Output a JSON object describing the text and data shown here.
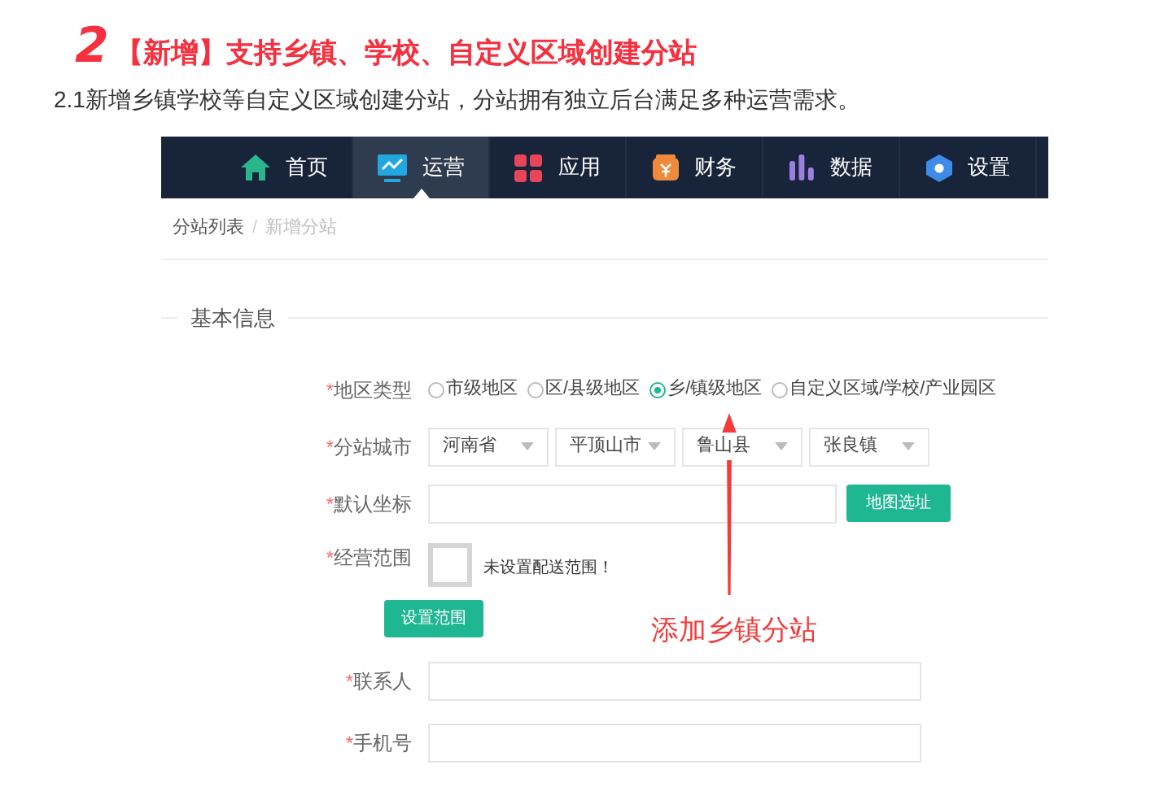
{
  "heading": {
    "number": "2",
    "title": "【新增】支持乡镇、学校、自定义区域创建分站"
  },
  "intro": "2.1新增乡镇学校等自定义区域创建分站，分站拥有独立后台满足多种运营需求。",
  "nav": [
    {
      "label": "首页",
      "selected": false
    },
    {
      "label": "运营",
      "selected": true
    },
    {
      "label": "应用",
      "selected": false
    },
    {
      "label": "财务",
      "selected": false
    },
    {
      "label": "数据",
      "selected": false
    },
    {
      "label": "设置",
      "selected": false
    }
  ],
  "breadcrumb": [
    {
      "label": "分站列表",
      "selected": false
    },
    {
      "label": "新增分站",
      "selected": true
    }
  ],
  "breadcrumb_separator": "/",
  "section_title": "基本信息",
  "form": {
    "region_type": {
      "label": "地区类型",
      "options": [
        {
          "label": "市级地区",
          "selected": false
        },
        {
          "label": "区/县级地区",
          "selected": false
        },
        {
          "label": "乡/镇级地区",
          "selected": true
        },
        {
          "label": "自定义区域/学校/产业园区",
          "selected": false
        }
      ]
    },
    "city": {
      "label": "分站城市",
      "selects": [
        "河南省",
        "平顶山市",
        "鲁山县",
        "张良镇"
      ]
    },
    "coordinate": {
      "label": "默认坐标",
      "button": "地图选址"
    },
    "scope": {
      "label": "经营范围",
      "note": "未设置配送范围！",
      "button": "设置范围"
    },
    "contact": {
      "label": "联系人"
    },
    "phone": {
      "label": "手机号"
    },
    "required_mark": "*"
  },
  "annotation": {
    "text": "添加乡镇分站"
  }
}
